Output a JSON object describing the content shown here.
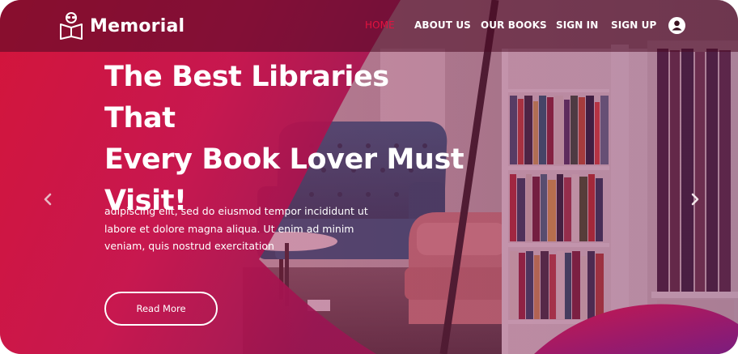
{
  "brand": {
    "name": "Memorial",
    "icon": "book-reader-icon"
  },
  "nav": {
    "items": [
      {
        "label": "HOME",
        "active": true
      },
      {
        "label": "ABOUT US",
        "active": false
      },
      {
        "label": "OUR BOOKS",
        "active": false
      },
      {
        "label": "SIGN IN",
        "active": false
      },
      {
        "label": "SIGN UP",
        "active": false
      }
    ],
    "user_icon": "user-icon"
  },
  "hero": {
    "title_lines": [
      "The Best Libraries That",
      "Every Book Lover Must",
      "Visit!"
    ],
    "description_lines": [
      "adipiscing elit, sed do eiusmod tempor incididunt ut",
      "labore et dolore magna aliqua. Ut enim ad minim",
      "veniam, quis nostrud exercitation"
    ],
    "cta_label": "Read More"
  },
  "carousel": {
    "prev_icon": "chevron-left-icon",
    "next_icon": "chevron-right-icon"
  },
  "colors": {
    "accent": "#e3123f",
    "overlay": "#c8103c",
    "navbar": "#4b0a23",
    "text": "#ffffff"
  }
}
